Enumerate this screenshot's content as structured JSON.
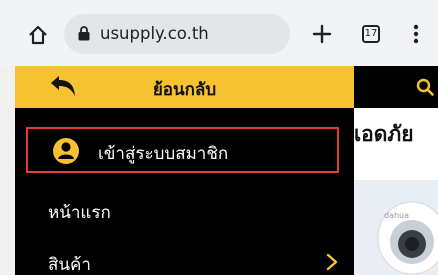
{
  "browser": {
    "url": "usupply.co.th",
    "tab_count": "17",
    "icons": {
      "home": "home-icon",
      "lock": "lock-icon",
      "new_tab": "plus-icon",
      "tabs": "tab-switcher-icon",
      "menu": "kebab-menu-icon"
    }
  },
  "drawer": {
    "back_label": "ย้อนกลับ",
    "login_label": "เข้าสู่ระบบสมาชิก",
    "items": [
      {
        "label": "หน้าแรก",
        "has_submenu": false
      },
      {
        "label": "สินค้า",
        "has_submenu": true
      }
    ],
    "colors": {
      "header_bg": "#f6c230",
      "drawer_bg": "#000000",
      "highlight_border": "#e53935",
      "accent": "#f6c230"
    }
  },
  "page": {
    "banner_text": "เอดภัย"
  }
}
